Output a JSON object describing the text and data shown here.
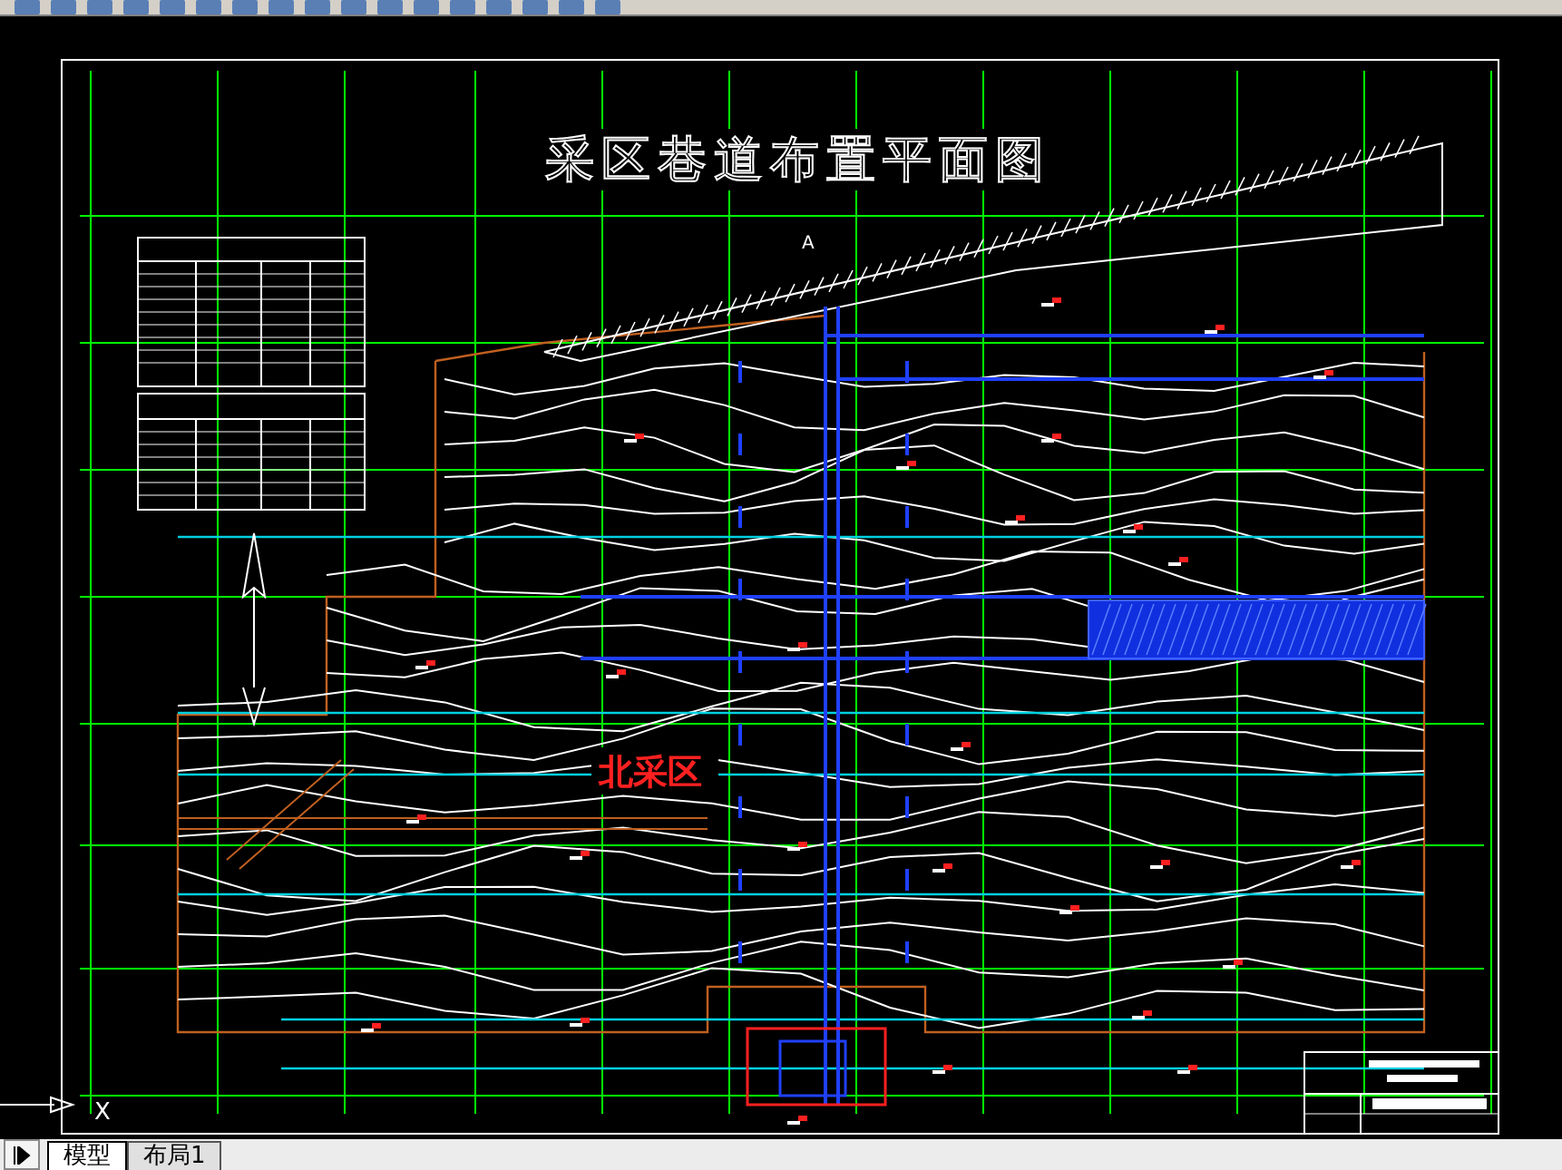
{
  "drawing": {
    "title": "采区巷道布置平面图",
    "area_label": "北采区",
    "section_mark": "A",
    "ucs_axis_label": "X"
  },
  "tabs": [
    {
      "label": "模型",
      "selected": true
    },
    {
      "label": "布局1",
      "selected": false
    }
  ]
}
